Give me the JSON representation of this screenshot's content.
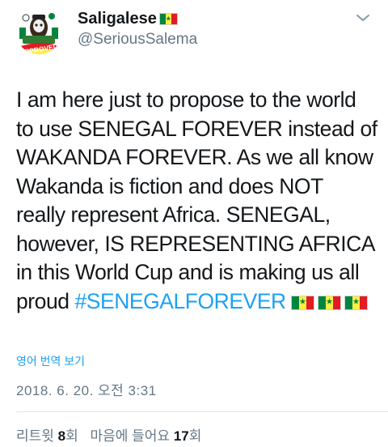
{
  "user": {
    "display_name": "Saligalese",
    "handle": "@SeriousSalema",
    "avatar_badge": "APPROVED",
    "flag_colors": [
      "#00853f",
      "#fdef42",
      "#e31b23"
    ]
  },
  "tweet": {
    "lines": [
      "I am here just to propose to the world",
      "to use SENEGAL FOREVER instead of",
      "WAKANDA FOREVER. As we all know",
      "Wakanda is fiction and does NOT",
      "really represent Africa. SENEGAL,",
      "however, IS REPRESENTING AFRICA",
      "in this World Cup and is making us all"
    ],
    "last_line_text": "proud ",
    "hashtag": "#SENEGALFOREVER",
    "flag_emoji_count": 3
  },
  "translate_label": "영어 번역 보기",
  "timestamp": "2018. 6. 20. 오전 3:31",
  "stats": {
    "retweets_label": "리트윗",
    "retweets_count": "8",
    "retweets_unit": "회",
    "likes_label": "마음에 들어요",
    "likes_count": "17",
    "likes_unit": "회"
  },
  "colors": {
    "link": "#1da1f2",
    "secondary_text": "#657786",
    "primary_text": "#14171a"
  }
}
